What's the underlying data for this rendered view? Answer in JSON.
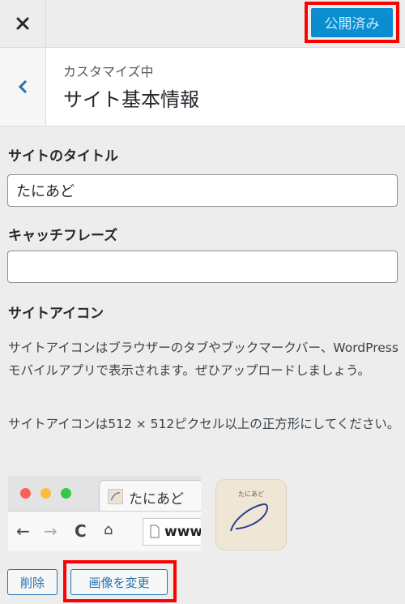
{
  "topbar": {
    "close_icon": "close-icon",
    "publish_label": "公開済み"
  },
  "header": {
    "back_icon": "chevron-left-icon",
    "subtitle": "カスタマイズ中",
    "title": "サイト基本情報"
  },
  "fields": {
    "site_title_label": "サイトのタイトル",
    "site_title_value": "たにあど",
    "tagline_label": "キャッチフレーズ",
    "tagline_value": ""
  },
  "site_icon": {
    "heading": "サイトアイコン",
    "description": "サイトアイコンはブラウザーのタブやブックマークバー、WordPress モバイルアプリで表示されます。ぜひアップロードしましょう。",
    "size_note": "サイトアイコンは512 × 512ピクセル以上の正方形にしてください。",
    "preview_tab_label": "たにあど",
    "preview_url": "www.",
    "icon_text": "たにあど",
    "remove_label": "削除",
    "change_label": "画像を変更"
  },
  "colors": {
    "accent": "#0a8ed0",
    "highlight": "#ff0000",
    "link": "#2271b1"
  }
}
